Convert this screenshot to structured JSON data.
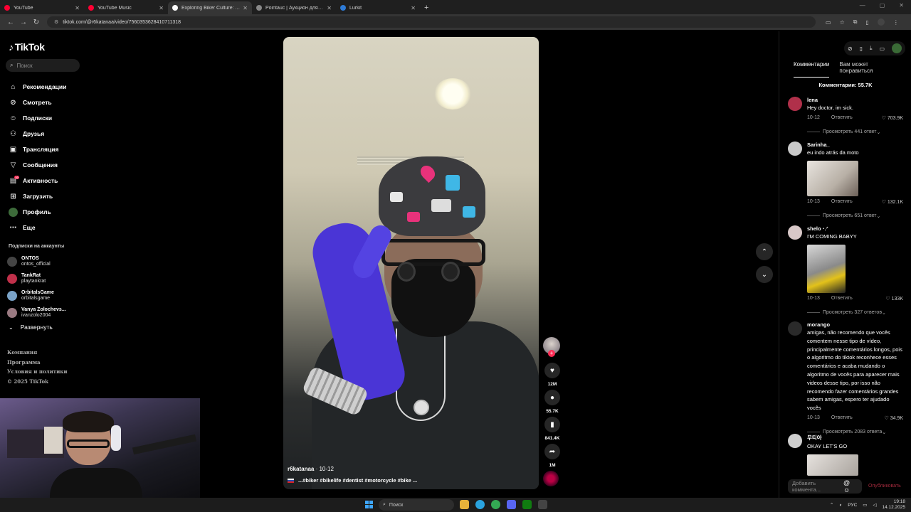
{
  "browser": {
    "tabs": [
      {
        "label": "YouTube",
        "color": "#ff0033"
      },
      {
        "label": "YouTube Music",
        "color": "#ff0033"
      },
      {
        "label": "Exploring Biker Culture: A D",
        "color": "#ffffff",
        "active": true
      },
      {
        "label": "Pointauc | Аукцион для стрим",
        "color": "#888888"
      },
      {
        "label": "Lurkit",
        "color": "#2e7bd6"
      }
    ],
    "url": "tiktok.com/@r6katanaa/video/7560353628410711318"
  },
  "tiktok": {
    "logo": "TikTok",
    "search_placeholder": "Поиск",
    "nav": [
      {
        "label": "Рекомендации",
        "icon": "home-icon",
        "glyph": "⌂"
      },
      {
        "label": "Смотреть",
        "icon": "compass-icon",
        "glyph": "⊘"
      },
      {
        "label": "Подписки",
        "icon": "following-icon",
        "glyph": "☺"
      },
      {
        "label": "Друзья",
        "icon": "friends-icon",
        "glyph": "⚇"
      },
      {
        "label": "Трансляция",
        "icon": "live-icon",
        "glyph": "▣"
      },
      {
        "label": "Сообщения",
        "icon": "messages-icon",
        "glyph": "▽"
      },
      {
        "label": "Активность",
        "icon": "activity-icon",
        "glyph": "▤"
      },
      {
        "label": "Загрузить",
        "icon": "upload-icon",
        "glyph": "⊞"
      },
      {
        "label": "Профиль",
        "icon": "profile-icon",
        "glyph": "●"
      },
      {
        "label": "Еще",
        "icon": "more-icon",
        "glyph": "⋯"
      }
    ],
    "activity_badge": "10",
    "following_heading": "Подписки на аккаунты",
    "following": [
      {
        "name": "ONTOS",
        "handle": "ontos_official",
        "color": "#444444"
      },
      {
        "name": "TankRat",
        "handle": "playtankrat",
        "color": "#c0304a"
      },
      {
        "name": "OrbitalsGame",
        "handle": "orbitalsgame",
        "color": "#7aa3c8"
      },
      {
        "name": "Vanya Zolochevs...",
        "handle": "ivanzolo2004",
        "color": "#9a7a82"
      }
    ],
    "expand_label": "Развернуть",
    "footer": [
      "Компания",
      "Программа",
      "Условия и политики",
      "© 2025 TikTok"
    ]
  },
  "video": {
    "author": "r6katanaa",
    "date": "10-12",
    "tags": "...#biker #bikelife #dentist #motorcycle #bike ...",
    "likes": "12M",
    "comments": "55.7K",
    "saves": "841.4K",
    "shares": "1M"
  },
  "comments_panel": {
    "tabs": [
      "Комментарии",
      "Вам может понравиться"
    ],
    "count_label": "Комментарии: 55.7K",
    "comments": [
      {
        "user": "lena",
        "text": "Hey doctor, im sick.",
        "date": "10-12",
        "reply": "Ответить",
        "likes": "703.9K",
        "replies": "Просмотреть 441 ответ",
        "avatar": "#b0304a"
      },
      {
        "user": "Sarinha_",
        "text": "eu indo atrás da moto",
        "date": "10-13",
        "reply": "Ответить",
        "likes": "132.1K",
        "replies": "Просмотреть 651 ответ",
        "avatar": "#c9c9c9"
      },
      {
        "user": "shelo ⋅.ᐟ",
        "text": "I'M COMING BABYY",
        "date": "10-13",
        "reply": "Ответить",
        "likes": "133K",
        "replies": "Просмотреть 327 ответов",
        "avatar": "#d8c8c8"
      },
      {
        "user": "morango",
        "text": "amigas, não recomendo que vocês comentem nesse tipo de vídeo, principalmente comentários longos, pois o algoritmo do tiktok reconhece esses comentários e acaba mudando o algoritmo de vocês para aparecer mais videos desse tipo, por isso não recomendo fazer comentários grandes sabem amigas, espero ter ajudado vocês",
        "date": "10-13",
        "reply": "Ответить",
        "likes": "34.9K",
        "replies": "Просмотреть 2083 ответа",
        "avatar": "#2a2a2a"
      },
      {
        "user": "무티아",
        "text": "OKAY LET'S GO",
        "avatar": "#cfcfcf"
      }
    ],
    "add_comment_placeholder": "Добавить коммента...",
    "post_label": "Опубликовать"
  },
  "taskbar": {
    "search": "Поиск",
    "lang": "РУС",
    "time": "19:18",
    "date": "14.12.2025"
  }
}
